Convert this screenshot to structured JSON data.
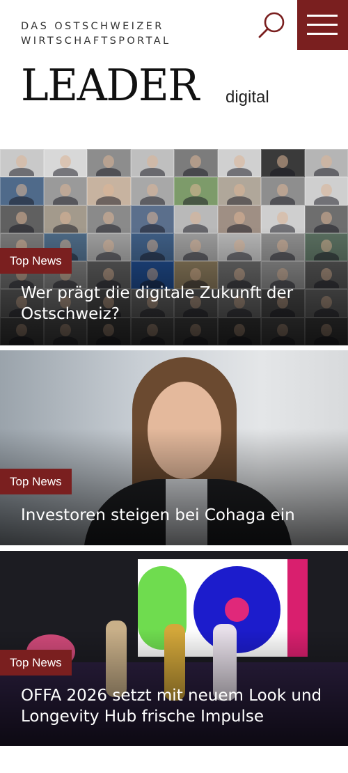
{
  "header": {
    "tagline_line1": "DAS OSTSCHWEIZER",
    "tagline_line2": "WIRTSCHAFTSPORTAL",
    "logo_main": "LEADER",
    "logo_sub": "digital",
    "search_icon": "search-icon",
    "menu_icon": "hamburger-menu-icon",
    "brand_color": "#7a1f1f"
  },
  "articles": [
    {
      "badge": "Top News",
      "title": "Wer prägt die digitale Zukunft der Ostschweiz?"
    },
    {
      "badge": "Top News",
      "title": "Investoren steigen bei Cohaga ein"
    },
    {
      "badge": "Top News",
      "title": "OFFA 2026 setzt mit neuem Look und Longevity Hub frische Impulse"
    }
  ]
}
